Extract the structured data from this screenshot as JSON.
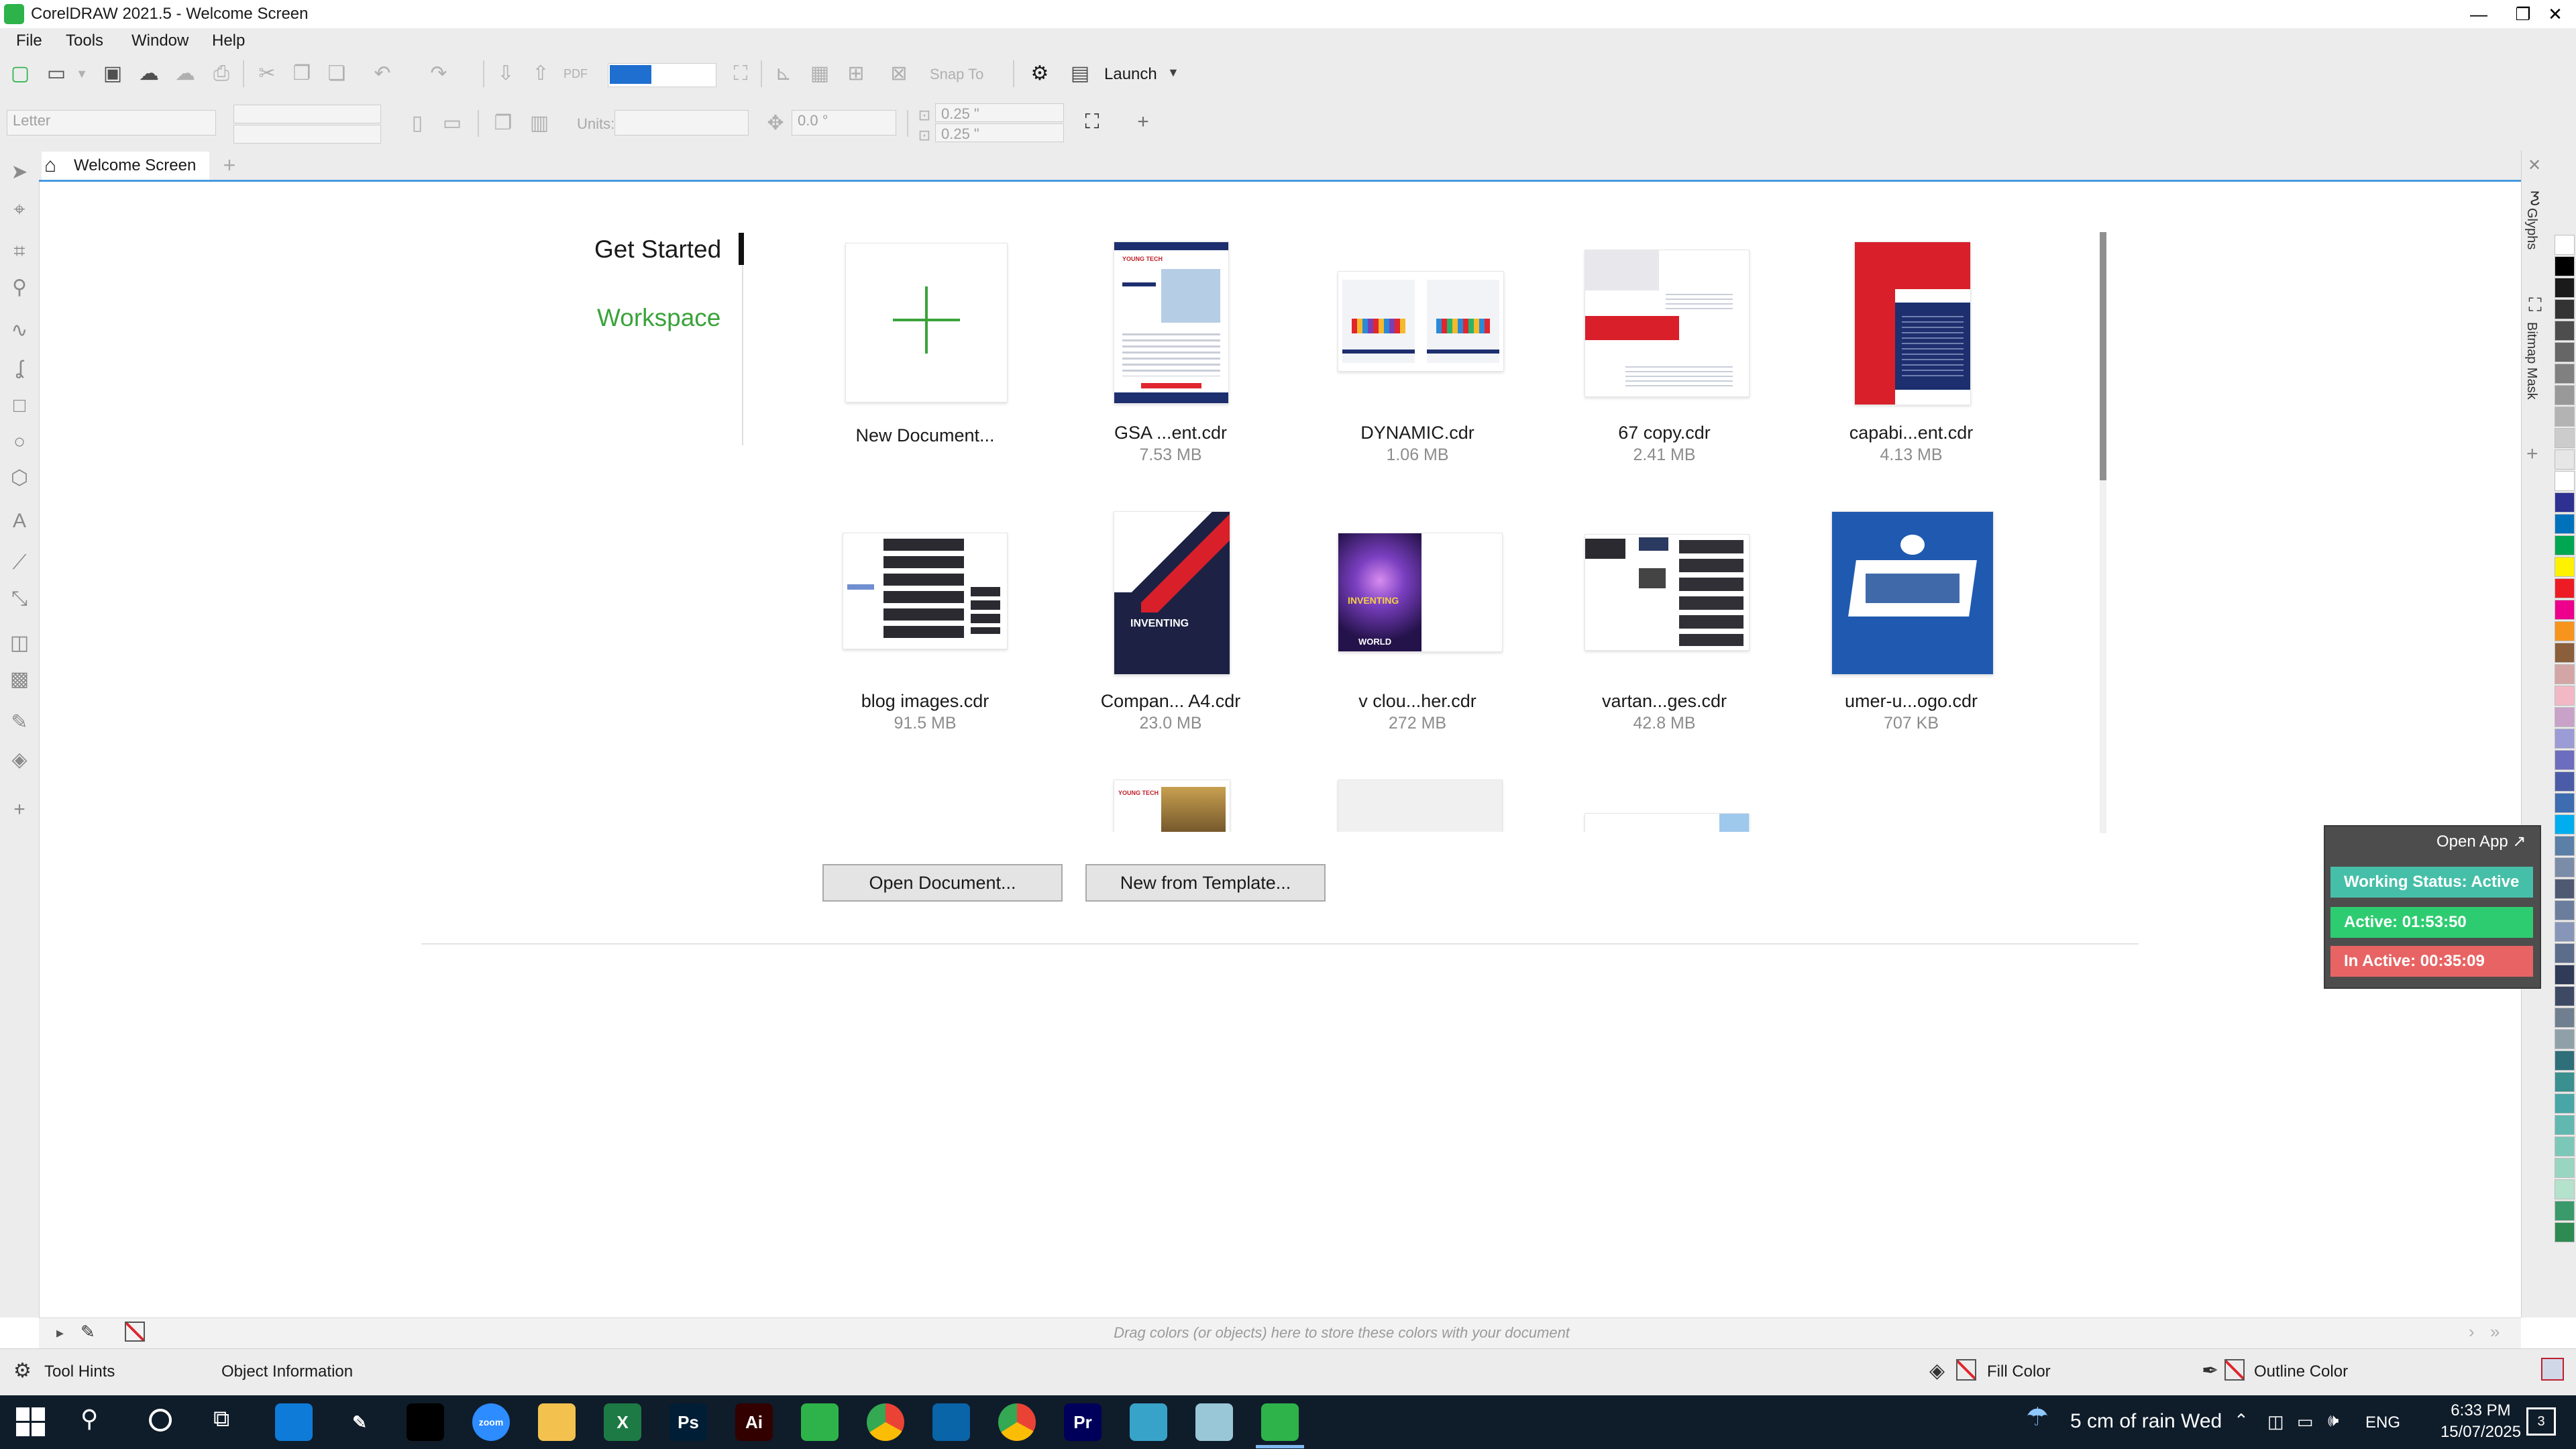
{
  "window": {
    "title": "CorelDRAW 2021.5 - Welcome Screen",
    "controls": {
      "minimize": "—",
      "maximize": "❐",
      "close": "✕"
    }
  },
  "menu": {
    "items": [
      "File",
      "Tools",
      "Window",
      "Help"
    ]
  },
  "toolbar": {
    "snap_label": "Snap To",
    "launch_label": "Launch",
    "zoom_value": ""
  },
  "property_bar": {
    "page_size": "Letter",
    "units_label": "Units:",
    "rotation": "0.0 °",
    "nudge_x": "0.25 \"",
    "nudge_y": "0.25 \""
  },
  "tabs": {
    "welcome": "Welcome Screen",
    "add_icon": "+"
  },
  "welcome": {
    "nav": {
      "get_started": "Get Started",
      "workspace": "Workspace"
    },
    "new_document": "New Document...",
    "files": [
      {
        "name": "GSA ...ent.cdr",
        "size": "7.53 MB"
      },
      {
        "name": "DYNAMIC.cdr",
        "size": "1.06 MB"
      },
      {
        "name": "67 copy.cdr",
        "size": "2.41 MB"
      },
      {
        "name": "capabi...ent.cdr",
        "size": "4.13 MB"
      },
      {
        "name": "blog images.cdr",
        "size": "91.5 MB"
      },
      {
        "name": "Compan... A4.cdr",
        "size": "23.0 MB"
      },
      {
        "name": "v clou...her.cdr",
        "size": "272 MB"
      },
      {
        "name": "vartan...ges.cdr",
        "size": "42.8 MB"
      },
      {
        "name": "umer-u...ogo.cdr",
        "size": "707 KB"
      }
    ],
    "thumb_text": {
      "inventing": "INVENTING",
      "world": "WORLD",
      "logo_mark": "YOUNG TECH"
    },
    "buttons": {
      "open": "Open Document...",
      "template": "New from Template..."
    }
  },
  "dockers": {
    "glyphs": "Glyphs",
    "bitmap_mask": "Bitmap Mask"
  },
  "doc_palette": {
    "hint": "Drag colors (or objects) here to store these colors with your document"
  },
  "status": {
    "tool_hints": "Tool Hints",
    "object_info": "Object Information",
    "fill_color": "Fill Color",
    "outline_color": "Outline Color"
  },
  "widget": {
    "open_app": "Open App ↗",
    "working_status": "Working Status: Active",
    "active": "Active: 01:53:50",
    "inactive": "In Active: 00:35:09",
    "colors": {
      "working": "#46bfa8",
      "active": "#2ecc71",
      "inactive": "#e86464"
    }
  },
  "taskbar": {
    "weather": "5 cm of rain Wed",
    "language": "ENG",
    "time": "6:33 PM",
    "date": "15/07/2025",
    "notifications": "3",
    "apps": [
      {
        "name": "edge",
        "label": "",
        "color": "#0f7bd8"
      },
      {
        "name": "pen",
        "label": "✎",
        "color": "transparent"
      },
      {
        "name": "terminal",
        "label": "",
        "color": "#000000"
      },
      {
        "name": "zoom",
        "label": "zoom",
        "color": "#2d8cff"
      },
      {
        "name": "explorer",
        "label": "",
        "color": "#f2c14e"
      },
      {
        "name": "excel",
        "label": "X",
        "color": "#1d7a45"
      },
      {
        "name": "photoshop",
        "label": "Ps",
        "color": "#001e36"
      },
      {
        "name": "illustrator",
        "label": "Ai",
        "color": "#330000"
      },
      {
        "name": "coreldraw",
        "label": "",
        "color": "#2db34a"
      },
      {
        "name": "chrome",
        "label": "",
        "color": "transparent"
      },
      {
        "name": "vscode",
        "label": "",
        "color": "#0a64a8"
      },
      {
        "name": "chrome2",
        "label": "",
        "color": "transparent"
      },
      {
        "name": "premiere",
        "label": "Pr",
        "color": "#00005b"
      },
      {
        "name": "app-diamond",
        "label": "",
        "color": "#38a3c9"
      },
      {
        "name": "app-glass",
        "label": "",
        "color": "#9ac7d8"
      },
      {
        "name": "coreldraw-active",
        "label": "",
        "color": "#2db34a"
      }
    ]
  },
  "palette_colors": [
    "#ffffff",
    "#000000",
    "#1a1a1a",
    "#333333",
    "#4d4d4d",
    "#666666",
    "#808080",
    "#999999",
    "#b3b3b3",
    "#cccccc",
    "#e6e6e6",
    "#ffffff",
    "#2e3192",
    "#0072bc",
    "#00a651",
    "#fff200",
    "#ed1c24",
    "#ec008c",
    "#f7941d",
    "#8b5e3c",
    "#d4a5a5",
    "#f2b8c6",
    "#c8a2c8",
    "#9b9bd6",
    "#6d6dbf",
    "#4a5ca8",
    "#3d6cb0",
    "#00aeef",
    "#5b7fa6",
    "#7b8ca8",
    "#4f5a72",
    "#6b7d9c",
    "#8796b8",
    "#5c6d8c",
    "#2f3b57",
    "#3e4a63",
    "#6f7f8f",
    "#8fa0a8",
    "#2e6f7a",
    "#3a8f8f",
    "#48a6a6",
    "#60b8b0",
    "#7cc8b8",
    "#98d6c2",
    "#b4e2cc",
    "#3a9a6a",
    "#2d8a50"
  ]
}
